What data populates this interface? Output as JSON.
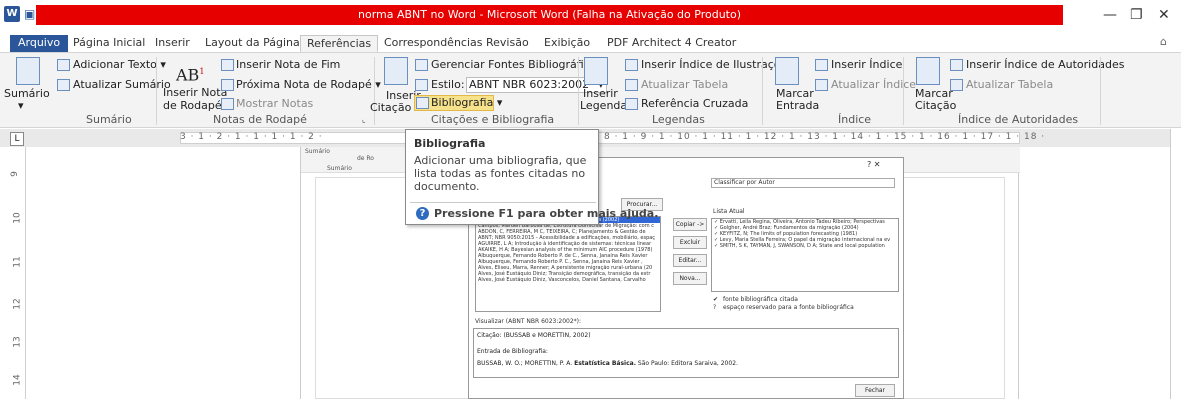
{
  "window": {
    "title": "norma ABNT no Word - Microsoft Word (Falha na Ativação do Produto)",
    "title_bar_color": "#e60000",
    "app_icon": "word-icon",
    "controls": [
      "—",
      "❐",
      "✕"
    ]
  },
  "quick_access": [
    "save-icon",
    "undo-icon",
    "redo-icon",
    "customize-icon"
  ],
  "tabs": {
    "file": "Arquivo",
    "items": [
      "Página Inicial",
      "Inserir",
      "Layout da Página",
      "Referências",
      "Correspondências",
      "Revisão",
      "Exibição",
      "PDF Architect 4 Creator"
    ],
    "active": "Referências"
  },
  "ribbon": {
    "sumario": {
      "big_button": "Sumário",
      "add_text": "Adicionar Texto ▾",
      "update": "Atualizar Sumário",
      "label": "Sumário"
    },
    "notas": {
      "big_button_line1": "Inserir Nota",
      "big_button_line2": "de Rodapé",
      "insert_end": "Inserir Nota de Fim",
      "next_footnote": "Próxima Nota de Rodapé ▾",
      "show_notes": "Mostrar Notas",
      "label": "Notas de Rodapé",
      "ab_glyph": "AB"
    },
    "citacoes": {
      "big_button_line1": "Inserir",
      "big_button_line2": "Citação ▾",
      "manage": "Gerenciar Fontes Bibliográficas",
      "style_label": "Estilo:",
      "style_value": "ABNT NBR 6023:2002* ▾",
      "bibliography": "Bibliografia ▾",
      "label": "Citações e Bibliografia"
    },
    "legendas": {
      "big_button_line1": "Inserir",
      "big_button_line2": "Legenda",
      "insert_illustrations": "Inserir Índice de Ilustrações",
      "update_table": "Atualizar Tabela",
      "cross_ref": "Referência Cruzada",
      "label": "Legendas"
    },
    "indice": {
      "big_button_line1": "Marcar",
      "big_button_line2": "Entrada",
      "insert_index": "Inserir Índice",
      "update_index": "Atualizar Índice",
      "label": "Índice"
    },
    "autoridades": {
      "big_button_line1": "Marcar",
      "big_button_line2": "Citação",
      "insert": "Inserir Índice de Autoridades",
      "update": "Atualizar Tabela",
      "label": "Índice de Autoridades"
    }
  },
  "ruler": {
    "numbers": "3 · 1 · 2 · 1 · 1 · 1 · 1 · 2 ·",
    "numbers_right": "8 · 1 · 9 · 1 · 10 · 1 · 11 · 1 · 12 · 1 · 13 · 1 · 14 · 1 · 15 · 1 · 16 · 1 · 17 · 1 · 18 ·",
    "vertical": [
      "9",
      "10",
      "11",
      "12",
      "13",
      "14"
    ]
  },
  "tooltip": {
    "title": "Bibliografia",
    "description": "Adicionar uma bibliografia, que lista todas as fontes citadas no documento.",
    "help": "Pressione F1 para obter mais ajuda."
  },
  "embedded": {
    "mini_labels": [
      "Sumário",
      "Sumário",
      "de Ro"
    ],
    "dialog": {
      "sort_label": "Classificar por Autor",
      "search_button": "Procurar...",
      "copy_button": "Copiar ->",
      "delete_button": "Excluir",
      "edit_button": "Editar...",
      "new_button": "Nova...",
      "current_list_label": "Lista Atual",
      "master_list": [
        "BUSSAB, W.O.; MORETTIN, P. A. Estatística Básica (2002)",
        "Campos, Marden Barbosa de; Estrutura Domiciliar de Migração: com c",
        "ABDON, C, FERREIRA, M C, TEIXEIRA, C; Planejamento & Gestão de",
        "ABNT; NBR 9050:2015 - Acessibilidade a edificações, mobiliário, espaç",
        "AGUIRRE, L A; Introdução à identificação de sistemas: técnicas linear",
        "AKAIKE, H A; Bayesian analysis of the minimum AIC procedure (1978)",
        "Albuquerque, Fernando Roberto P. de C., Senna, Janaina Reis Xavier",
        "Albuquerque, Fernando Roberto P. C., Senna, Janaina Reis Xavier ,",
        "Alves, Eliseu, Marra, Renner; A persistente migração rural-urbana (20",
        "Alves, José Eustáquio Diniz; Transição demográfica, transição da estr",
        "Alves, José Eustáquio Diniz, Vasconcelos, Daniel Santana, Carvalho"
      ],
      "current_list": [
        "✓ Ervatti, Leila Regina, Oliveira, Antonio Tadeu Ribeiro; Perspectivas",
        "✓ Golgher, André Braz; Fundamentos da migração (2004)",
        "✓ KEYFITZ, N; The limits of population forecasting (1981)",
        "✓ Levy, Maria Stella Ferreira; O papel da migração internacional na ev",
        "✓ SMITH, S K, TAYMAN, J, SWANSON, D A; State and local population"
      ],
      "legend_cited": "fonte bibliográfica citada",
      "legend_placeholder": "espaço reservado para a fonte bibliográfica",
      "preview_label": "Visualizar (ABNT NBR 6023:2002*):",
      "preview_citation": "Citação:  (BUSSAB e MORETTIN, 2002)",
      "preview_entry_label": "Entrada de Bibliografia:",
      "preview_entry_authors": "BUSSAB, W. O.; MORETTIN, P. A.",
      "preview_entry_title": "Estatística Básica.",
      "preview_entry_rest": "São Paulo: Editora Saraiva, 2002.",
      "close_button": "Fechar",
      "header_controls": "?   ✕"
    }
  }
}
